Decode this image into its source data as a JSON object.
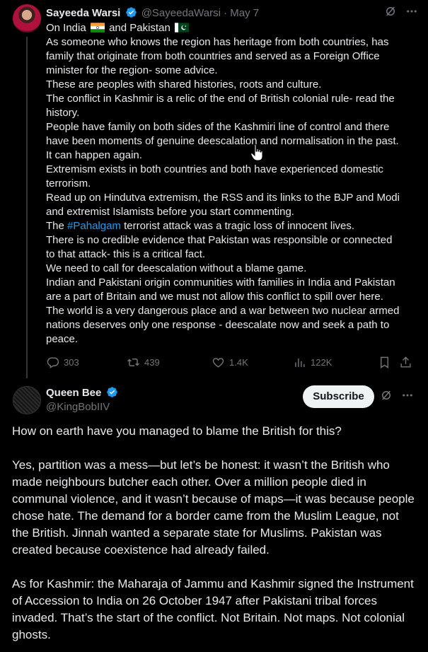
{
  "tweet1": {
    "display_name": "Sayeeda Warsi",
    "handle": "@SayeedaWarsi",
    "separator": "·",
    "date": "May 7",
    "intro_a": "On India",
    "intro_b": "and Pakistan",
    "lines": [
      "As someone who knows the region has heritage from both countries, has",
      "family that originate from both countries and served as a Foreign Office",
      "minister for the region- some advice.",
      "These are peoples with shared histories, roots and culture.",
      "The conflict in Kashmir is a relic of the end of British colonial rule- read the",
      "history.",
      "People have family on both sides of the Kashmiri line of control and there",
      "have been moments of genuine deescalation and normalisation in the past.",
      "It can happen again.",
      "Extremism exists in both countries and both have experienced domestic",
      "terrorism.",
      "Read up on Hindutva extremism, the RSS and its links to the BJP and Modi",
      "and extremist Islamists before you start commenting."
    ],
    "the_word": "The",
    "hashtag": "#Pahalgam",
    "hashtag_rest": "terrorist attack was a tragic loss of innocent lives.",
    "lines2": [
      "There is no credible evidence that Pakistan was responsible or connected",
      "to that attack- this is a critical fact.",
      "We need to call for deescalation without a blame game.",
      "Indian and Pakistani origin communities with families in India and Pakistan",
      "are a part of Britain and we must not allow this conflict to spill over here.",
      "The world is a very dangerous place and a war between two nuclear armed",
      "nations deserves only one response - deescalate now and seek a path to",
      "peace."
    ],
    "stats": {
      "replies": "303",
      "reposts": "439",
      "likes": "1.4K",
      "views": "122K"
    }
  },
  "tweet2": {
    "display_name": "Queen Bee",
    "handle": "@KingBobIIV",
    "subscribe_label": "Subscribe",
    "paragraphs": [
      "How on earth have you managed to blame the British for this?",
      "Yes, partition was a mess—but let’s be honest: it wasn’t the British who made neighbours butcher each other. Over a million people died in communal violence, and it wasn’t because of maps—it was because people chose hate. The demand for a border came from the Muslim League, not the British. Jinnah wanted a separate state for Muslims. Pakistan was created because coexistence had already failed.",
      "As for Kashmir: the Maharaja of Jammu and Kashmir signed the Instrument of Accession to India on 26 October 1947 after Pakistani tribal forces invaded. That’s the start of the conflict. Not Britain. Not maps. Not colonial ghosts."
    ]
  },
  "colors": {
    "background": "#000000",
    "text": "#e7e9ea",
    "muted": "#71767b",
    "link": "#1d9bf0",
    "verified": "#1d9bf0"
  },
  "icons": {
    "verified": "verified-badge-icon",
    "grok": "grok-icon",
    "more": "more-icon",
    "reply": "reply-icon",
    "repost": "repost-icon",
    "like": "like-icon",
    "views": "views-icon",
    "bookmark": "bookmark-icon",
    "share": "share-icon"
  }
}
